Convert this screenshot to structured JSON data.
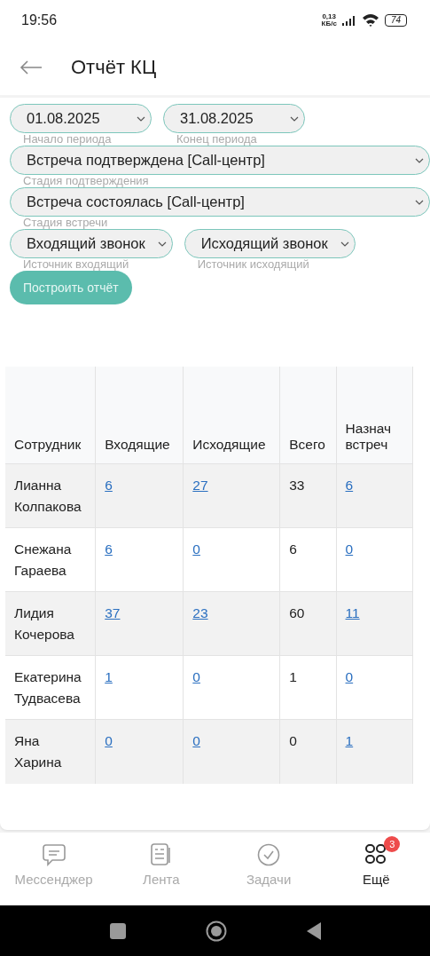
{
  "status_bar": {
    "time": "19:56",
    "speed_value": "0,13",
    "speed_unit": "КБ/с",
    "battery": "74"
  },
  "header": {
    "title": "Отчёт КЦ"
  },
  "filter_rows": [
    [
      {
        "value": "01.08.2025",
        "label": "Начало периода"
      },
      {
        "value": "31.08.2025",
        "label": "Конец периода"
      }
    ],
    [
      {
        "value": "Встреча подтверждена [Call-центр]",
        "label": "Стадия подтверждения"
      }
    ],
    [
      {
        "value": "Встреча состоялась [Call-центр]",
        "label": "Стадия встречи"
      }
    ],
    [
      {
        "value": "Входящий звонок",
        "label": "Источник входящий"
      },
      {
        "value": "Исходящий звонок",
        "label": "Источник исходящий"
      }
    ]
  ],
  "build_button": "Построить отчёт",
  "table": {
    "columns": [
      {
        "label": "Сотрудник",
        "kind": "text"
      },
      {
        "label": "Входящие",
        "kind": "link"
      },
      {
        "label": "Исходящие",
        "kind": "link"
      },
      {
        "label": "Всего",
        "kind": "text"
      },
      {
        "label": "Назнач встреч",
        "kind": "link"
      }
    ],
    "rows": [
      [
        "Лианна Колпакова",
        "6",
        "27",
        "33",
        "6"
      ],
      [
        "Снежана Гараева",
        "6",
        "0",
        "6",
        "0"
      ],
      [
        "Лидия Кочерова",
        "37",
        "23",
        "60",
        "11"
      ],
      [
        "Екатерина Тудвасева",
        "1",
        "0",
        "1",
        "0"
      ],
      [
        "Яна Харина",
        "0",
        "0",
        "0",
        "1"
      ]
    ]
  },
  "bottom_nav": [
    {
      "label": "Мессенджер",
      "selected": false
    },
    {
      "label": "Лента",
      "selected": false
    },
    {
      "label": "Задачи",
      "selected": false
    },
    {
      "label": "Ещё",
      "selected": true,
      "badge": "3"
    }
  ]
}
